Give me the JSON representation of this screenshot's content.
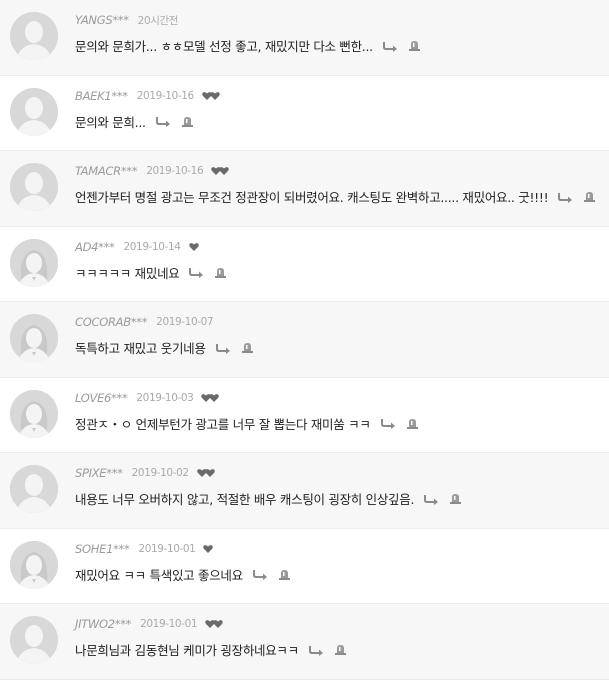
{
  "comments": [
    {
      "user": "YANGS***",
      "date": "20시간전",
      "hearts": 0,
      "text": "문의와 문희가... ㅎㅎ모델 선정 좋고, 재밌지만 다소 뻔한...",
      "avatar": "male-avatar-icon"
    },
    {
      "user": "BAEK1***",
      "date": "2019-10-16",
      "hearts": 2,
      "text": "문의와 문희...",
      "avatar": "male-avatar-icon"
    },
    {
      "user": "TAMACR***",
      "date": "2019-10-16",
      "hearts": 2,
      "text": "언젠가부터 명절 광고는 무조건 정관장이 되버렸어요. 캐스팅도 완벽하고..... 재밌어요.. 굿!!!!",
      "avatar": "male-avatar-icon"
    },
    {
      "user": "AD4***",
      "date": "2019-10-14",
      "hearts": 1,
      "text": "ㅋㅋㅋㅋㅋ 재밌네요",
      "avatar": "female-avatar-icon"
    },
    {
      "user": "COCORAB***",
      "date": "2019-10-07",
      "hearts": 0,
      "text": "독특하고 재밌고 웃기네용",
      "avatar": "female-avatar-icon"
    },
    {
      "user": "LOVE6***",
      "date": "2019-10-03",
      "hearts": 2,
      "text": "정관ㅈ・ㅇ 언제부턴가 광고를 너무 잘 뽑는다 재미쑴 ㅋㅋ",
      "avatar": "female-avatar-icon"
    },
    {
      "user": "SPIXE***",
      "date": "2019-10-02",
      "hearts": 2,
      "text": "내용도 너무 오버하지 않고, 적절한 배우 캐스팅이 굉장히 인상깊음.",
      "avatar": "male-avatar-icon"
    },
    {
      "user": "SOHE1***",
      "date": "2019-10-01",
      "hearts": 1,
      "text": "재밌어요 ㅋㅋ 특색있고 좋으네요",
      "avatar": "female-avatar-icon"
    },
    {
      "user": "JITWO2***",
      "date": "2019-10-01",
      "hearts": 2,
      "text": "나문희님과 김동현님 케미가 굉장하네요ㅋㅋ",
      "avatar": "male-avatar-icon"
    }
  ],
  "colors": {
    "heart": "#6a6a6a",
    "icon": "#8a8a8a",
    "avatar_bg": "#d8d8d8",
    "avatar_fg": "#f4f4f4"
  }
}
